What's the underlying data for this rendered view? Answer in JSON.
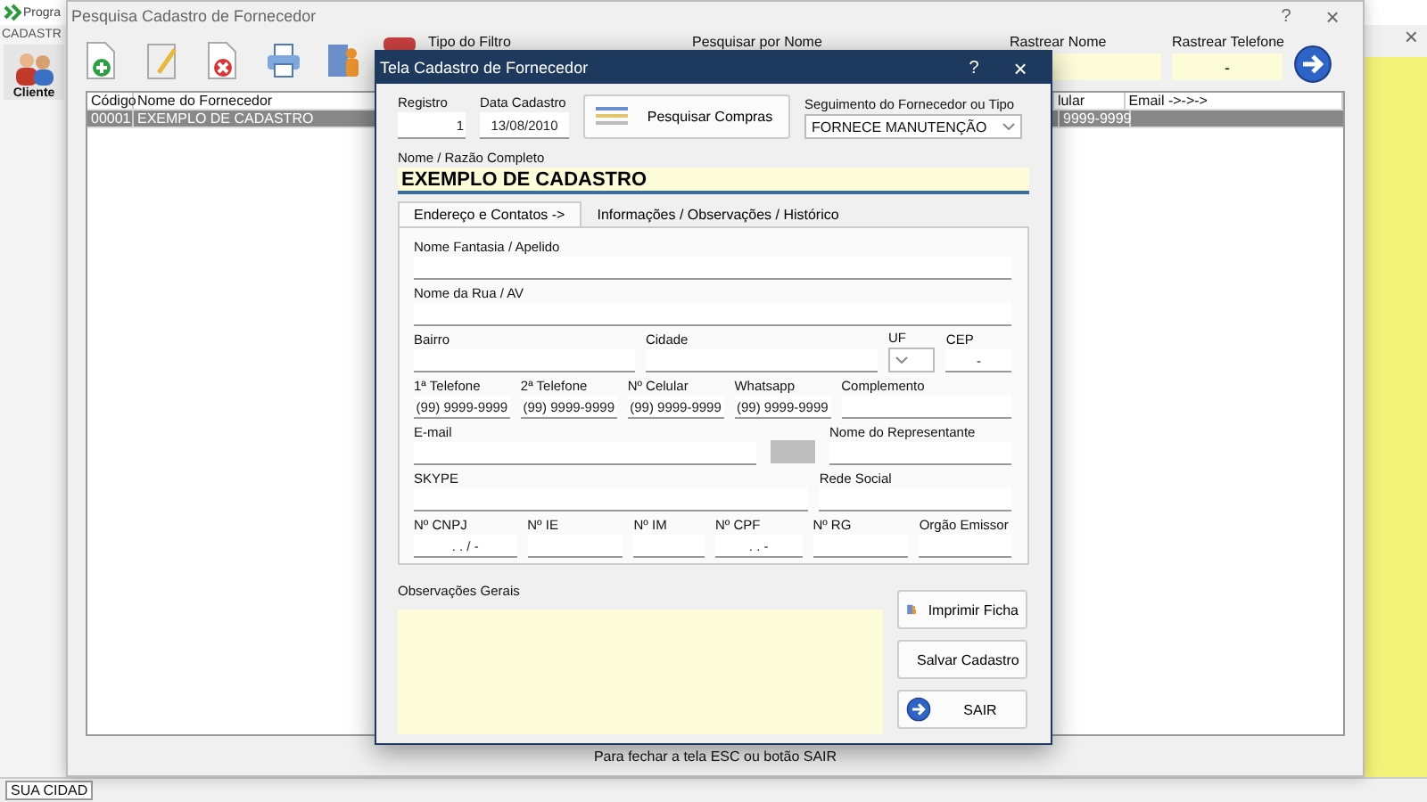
{
  "app": {
    "title": "Progra",
    "menu": [
      "CADASTR"
    ],
    "toolbar": [
      {
        "label": "Cliente"
      }
    ],
    "close": "×",
    "status_bar": [
      "SUA CIDAD"
    ]
  },
  "search_window": {
    "title": "Pesquisa Cadastro de Fornecedor",
    "help": "?",
    "close": "×",
    "toolbar": [
      {
        "kind": "new"
      },
      {
        "kind": "edit"
      },
      {
        "kind": "delete"
      },
      {
        "kind": "print"
      },
      {
        "kind": "exit"
      }
    ],
    "filters": [
      {
        "kind": "label",
        "label": "Tipo do Filtro"
      },
      {
        "kind": "label",
        "label": "Pesquisar por Nome"
      },
      {
        "kind": "field",
        "label": "Rastrear Nome"
      },
      {
        "kind": "field",
        "label": "Rastrear Telefone",
        "value": "-"
      }
    ],
    "table": {
      "columns": [
        "Código",
        "Nome do Fornecedor",
        "lular",
        "Email ->->->"
      ],
      "rows": [
        {
          "cells": [
            "00001",
            "EXEMPLO DE CADASTRO",
            "9999-9999"
          ],
          "selected": true
        }
      ]
    },
    "footer": "Para fechar a tela ESC ou botão SAIR"
  },
  "dialog": {
    "title": "Tela Cadastro de Fornecedor",
    "help": "?",
    "close": "×",
    "registro": {
      "label": "Registro",
      "value": "1"
    },
    "data_cadastro": {
      "label": "Data Cadastro",
      "value": "13/08/2010"
    },
    "search_purchases_button": "Pesquisar Compras",
    "segment": {
      "label": "Seguimento do Fornecedor ou Tipo",
      "value": "FORNECE MANUTENÇÃO"
    },
    "nome": {
      "label": "Nome / Razão Completo",
      "value": "EXEMPLO DE CADASTRO"
    },
    "tabs": [
      {
        "label": "Endereço e Contatos ->",
        "selected": true
      },
      {
        "label": "Informações / Observações / Histórico",
        "selected": false
      }
    ],
    "form_rows": [
      [
        {
          "kind": "text",
          "label": "Nome Fantasia / Apelido"
        }
      ],
      [
        {
          "kind": "text",
          "label": "Nome da Rua / AV"
        }
      ],
      [
        {
          "kind": "text",
          "label": "Bairro"
        },
        {
          "kind": "text",
          "label": "Cidade"
        },
        {
          "kind": "select",
          "label": "UF"
        },
        {
          "kind": "text",
          "label": "CEP",
          "value": "-"
        }
      ],
      [
        {
          "kind": "text",
          "label": "1ª Telefone",
          "value": "(99) 9999-9999"
        },
        {
          "kind": "text",
          "label": "2ª Telefone",
          "value": "(99) 9999-9999"
        },
        {
          "kind": "text",
          "label": "Nº Celular",
          "value": "(99) 9999-9999"
        },
        {
          "kind": "text",
          "label": "Whatsapp",
          "value": "(99) 9999-9999"
        },
        {
          "kind": "text",
          "label": "Complemento"
        }
      ],
      [
        {
          "kind": "text",
          "label": "E-mail"
        },
        {
          "kind": "button"
        },
        {
          "kind": "text",
          "label": "Nome do Representante"
        }
      ],
      [
        {
          "kind": "text",
          "label": "SKYPE"
        },
        {
          "kind": "text",
          "label": "Rede Social"
        }
      ],
      [
        {
          "kind": "text",
          "label": "Nº CNPJ",
          "value": ". . / -"
        },
        {
          "kind": "text",
          "label": "Nº IE"
        },
        {
          "kind": "text",
          "label": "Nº IM"
        },
        {
          "kind": "text",
          "label": "Nº CPF",
          "value": ". . -"
        },
        {
          "kind": "text",
          "label": "Nº RG"
        },
        {
          "kind": "text",
          "label": "Orgão Emissor"
        }
      ]
    ],
    "observations": {
      "label": "Observações Gerais"
    },
    "buttons": [
      {
        "kind": "print",
        "label": "Imprimir Ficha"
      },
      {
        "kind": "save",
        "label": "Salvar Cadastro"
      },
      {
        "kind": "exit",
        "label": "SAIR"
      }
    ]
  }
}
